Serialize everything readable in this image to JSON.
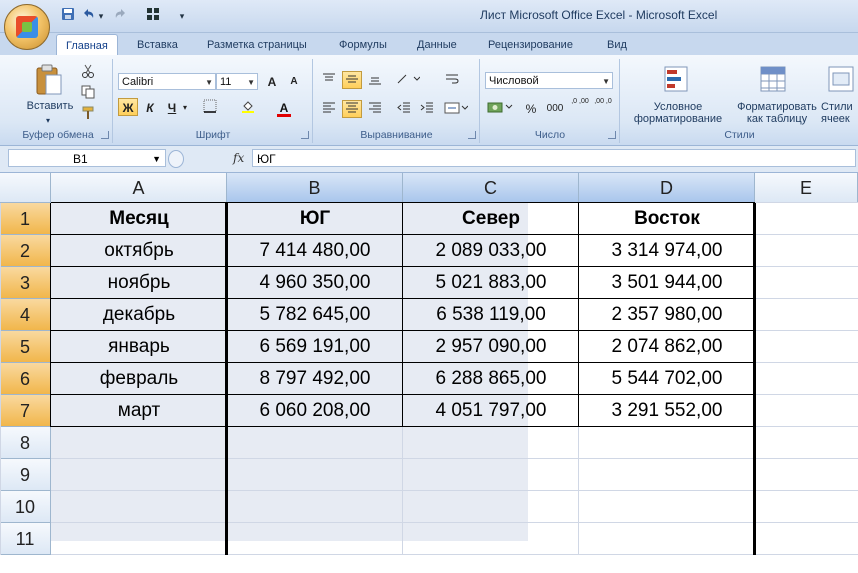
{
  "window": {
    "title": "Лист Microsoft Office Excel - Microsoft Excel"
  },
  "quick_access": {
    "undo_arrow": "▾",
    "customize_arrow": "▾"
  },
  "tabs": [
    "Главная",
    "Вставка",
    "Разметка страницы",
    "Формулы",
    "Данные",
    "Рецензирование",
    "Вид"
  ],
  "ribbon": {
    "clipboard": {
      "label": "Буфер обмена",
      "paste": "Вставить"
    },
    "font": {
      "label": "Шрифт",
      "font_name": "Calibri",
      "font_size": "11",
      "bold": "Ж",
      "italic": "К",
      "underline": "Ч",
      "grow": "A",
      "shrink": "A",
      "font_color": "A"
    },
    "alignment": {
      "label": "Выравнивание"
    },
    "number": {
      "label": "Число",
      "format": "Числовой",
      "percent": "%",
      "thousands": "000",
      "inc_decimal": ",0 ,00",
      "dec_decimal": ",00 ,0"
    },
    "styles": {
      "label": "Стили",
      "conditional_line1": "Условное",
      "conditional_line2": "форматирование",
      "table_line1": "Форматировать",
      "table_line2": "как таблицу",
      "cell_line1": "Стили",
      "cell_line2": "ячеек"
    }
  },
  "formula_bar": {
    "name_box": "B1",
    "fx": "fx",
    "formula": "ЮГ"
  },
  "columns": [
    "A",
    "B",
    "C",
    "D",
    "E"
  ],
  "rows": [
    "1",
    "2",
    "3",
    "4",
    "5",
    "6",
    "7",
    "8",
    "9",
    "10",
    "11"
  ],
  "table": {
    "headers": [
      "Месяц",
      "ЮГ",
      "Север",
      "Восток"
    ],
    "data": [
      [
        "октябрь",
        "7 414 480,00",
        "2 089 033,00",
        "3 314 974,00"
      ],
      [
        "ноябрь",
        "4 960 350,00",
        "5 021 883,00",
        "3 501 944,00"
      ],
      [
        "декабрь",
        "5 782 645,00",
        "6 538 119,00",
        "2 357 980,00"
      ],
      [
        "январь",
        "6 569 191,00",
        "2 957 090,00",
        "2 074 862,00"
      ],
      [
        "февраль",
        "8 797 492,00",
        "6 288 865,00",
        "5 544 702,00"
      ],
      [
        "март",
        "6 060 208,00",
        "4 051 797,00",
        "3 291 552,00"
      ]
    ]
  }
}
